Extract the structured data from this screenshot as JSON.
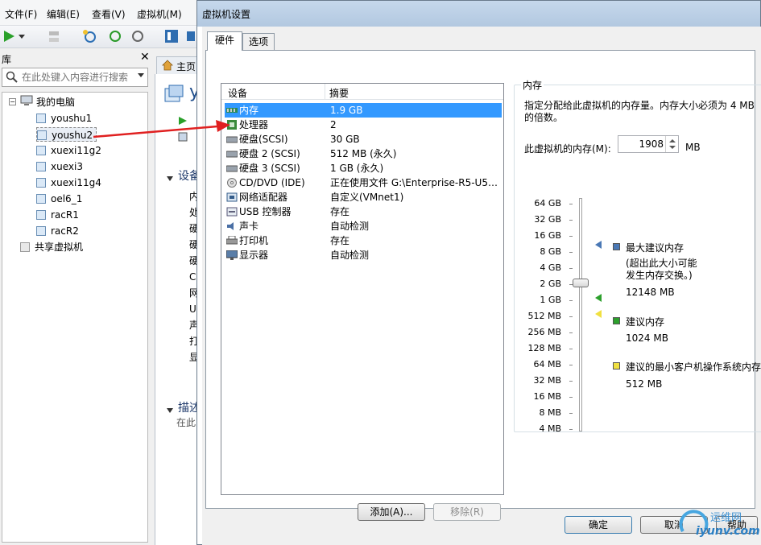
{
  "main_window": {
    "menu": [
      "文件(F)",
      "编辑(E)",
      "查看(V)",
      "虚拟机(M)"
    ],
    "library_title": "库",
    "search_placeholder": "在此处键入内容进行搜索",
    "tree": {
      "root": "我的电脑",
      "vms": [
        "youshu1",
        "youshu2",
        "xuexi11g2",
        "xuexi3",
        "xuexi11g4",
        "oel6_1",
        "racR1",
        "racR2"
      ],
      "shared": "共享虚拟机"
    },
    "home_tab": "主页",
    "partial": {
      "vm_title": "yo",
      "devices_section": "设备",
      "desc_section": "描述",
      "desc_text": "在此",
      "devices_short": [
        "内",
        "处",
        "硬",
        "硬",
        "硬",
        "C",
        "网",
        "U",
        "声",
        "打",
        "显"
      ]
    }
  },
  "dialog": {
    "title": "虚拟机设置",
    "tabs": [
      "硬件",
      "选项"
    ],
    "device_list": {
      "col_device": "设备",
      "col_summary": "摘要",
      "rows": [
        {
          "device": "内存",
          "summary": "1.9 GB",
          "icon": "memory-icon"
        },
        {
          "device": "处理器",
          "summary": "2",
          "icon": "processor-icon"
        },
        {
          "device": "硬盘(SCSI)",
          "summary": "30 GB",
          "icon": "hard-disk-icon"
        },
        {
          "device": "硬盘 2 (SCSI)",
          "summary": "512 MB (永久)",
          "icon": "hard-disk-icon"
        },
        {
          "device": "硬盘 3 (SCSI)",
          "summary": "1 GB (永久)",
          "icon": "hard-disk-icon"
        },
        {
          "device": "CD/DVD (IDE)",
          "summary": "正在使用文件 G:\\Enterprise-R5-U5-...",
          "icon": "cd-dvd-icon"
        },
        {
          "device": "网络适配器",
          "summary": "自定义(VMnet1)",
          "icon": "network-adapter-icon"
        },
        {
          "device": "USB 控制器",
          "summary": "存在",
          "icon": "usb-icon"
        },
        {
          "device": "声卡",
          "summary": "自动检测",
          "icon": "sound-card-icon"
        },
        {
          "device": "打印机",
          "summary": "存在",
          "icon": "printer-icon"
        },
        {
          "device": "显示器",
          "summary": "自动检测",
          "icon": "display-icon"
        }
      ],
      "selected_index": 0
    },
    "add_button": "添加(A)...",
    "remove_button": "移除(R)",
    "memory": {
      "group_title": "内存",
      "description": "指定分配给此虚拟机的内存量。内存大小必须为 4 MB 的倍数。",
      "field_label": "此虚拟机的内存(M):",
      "value": "1908",
      "unit": "MB",
      "scale": [
        "64 GB",
        "32 GB",
        "16 GB",
        "8 GB",
        "4 GB",
        "2 GB",
        "1 GB",
        "512 MB",
        "256 MB",
        "128 MB",
        "64 MB",
        "32 MB",
        "16 MB",
        "8 MB",
        "4 MB"
      ],
      "max_recommended_label": "最大建议内存",
      "max_recommended_note": "(超出此大小可能\n发生内存交换。)",
      "max_recommended_value": "12148 MB",
      "recommended_label": "建议内存",
      "recommended_value": "1024 MB",
      "min_guest_label": "建议的最小客户机操作系统内存",
      "min_guest_value": "512 MB"
    },
    "ok_button": "确定",
    "cancel_button": "取消",
    "help_button": "帮助"
  },
  "watermark": {
    "text_top": "运维网",
    "text_bottom": "iyunv.com"
  },
  "colors": {
    "selection": "#3399ff",
    "annotation_arrow": "#e02020",
    "max_marker": "#4a78b5",
    "recommended_marker": "#2ca02c",
    "min_marker": "#f0e040"
  }
}
